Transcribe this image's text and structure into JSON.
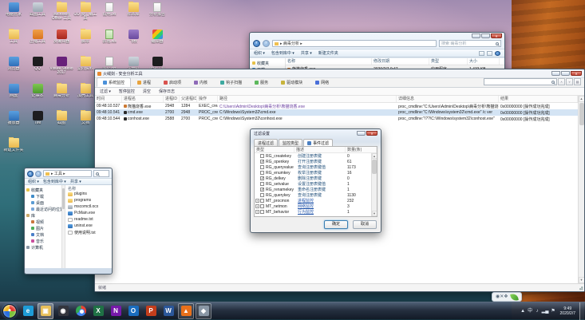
{
  "desktop": {
    "icons": [
      {
        "kind": "app-blue",
        "label": "电脑管家"
      },
      {
        "kind": "app-gray",
        "label": "截图工具"
      },
      {
        "kind": "folder",
        "label": "Microsoft Office 工具"
      },
      {
        "kind": "folder",
        "label": "OD 反汇编工具"
      },
      {
        "kind": "doc",
        "label": "说明.txt"
      },
      {
        "kind": "folder",
        "label": "样本库"
      },
      {
        "kind": "doc",
        "label": "分析报告"
      },
      {
        "kind": "none",
        "label": ""
      },
      {
        "kind": "folder",
        "label": "工具"
      },
      {
        "kind": "app-orange",
        "label": "压缩工具"
      },
      {
        "kind": "app-red",
        "label": "反编译器"
      },
      {
        "kind": "folder",
        "label": "脚本"
      },
      {
        "kind": "doc-green",
        "label": "表格.xls"
      },
      {
        "kind": "app-purple",
        "label": "飞秋"
      },
      {
        "kind": "app-rainbow",
        "label": "编译器"
      },
      {
        "kind": "none",
        "label": ""
      },
      {
        "kind": "app-blue",
        "label": "浏览器"
      },
      {
        "kind": "app-black",
        "label": "QQ"
      },
      {
        "kind": "app-vs",
        "label": "Visual Studio 2017"
      },
      {
        "kind": "folder",
        "label": "逆向资料"
      },
      {
        "kind": "doc",
        "label": "笔记.txt"
      },
      {
        "kind": "app-gray",
        "label": "注册机"
      },
      {
        "kind": "app-black",
        "label": "爬虫工具"
      },
      {
        "kind": "none",
        "label": ""
      },
      {
        "kind": "app-blue",
        "label": "网盘"
      },
      {
        "kind": "app-green",
        "label": "记事本"
      },
      {
        "kind": "folder",
        "label": "病毒分析"
      },
      {
        "kind": "folder",
        "label": "加壳工具"
      },
      {
        "kind": "app-redx",
        "label": "专杀工具"
      },
      {
        "kind": "app-orange",
        "label": "火狐浏览器"
      },
      {
        "kind": "none",
        "label": ""
      },
      {
        "kind": "none",
        "label": ""
      },
      {
        "kind": "app-blue",
        "label": "播放器"
      },
      {
        "kind": "app-black",
        "label": "TIM"
      },
      {
        "kind": "folder",
        "label": "截图"
      },
      {
        "kind": "folder",
        "label": "文档"
      },
      {
        "kind": "folder",
        "label": "资源"
      },
      {
        "kind": "none",
        "label": ""
      },
      {
        "kind": "none",
        "label": ""
      },
      {
        "kind": "none",
        "label": ""
      },
      {
        "kind": "folder",
        "label": "新建文件夹"
      },
      {
        "kind": "none",
        "label": ""
      },
      {
        "kind": "none",
        "label": ""
      },
      {
        "kind": "none",
        "label": ""
      },
      {
        "kind": "none",
        "label": ""
      },
      {
        "kind": "none",
        "label": ""
      },
      {
        "kind": "none",
        "label": ""
      },
      {
        "kind": "none",
        "label": ""
      }
    ]
  },
  "explorer_top": {
    "address": "▸ 病毒分析 ▸",
    "search_text": "搜索 病毒分析",
    "toolbar": [
      {
        "label": "组织 ▾"
      },
      {
        "label": "包含到库中 ▾"
      },
      {
        "label": "共享 ▾"
      },
      {
        "label": "新建文件夹"
      }
    ],
    "columns": [
      "名称",
      "修改日期",
      "类型",
      "大小"
    ],
    "sidebar": [
      {
        "label": "收藏夹",
        "color": "#e8c34a"
      },
      {
        "label": "下载",
        "color": "#3f8cc9"
      },
      {
        "label": "桌面",
        "color": "#5a9bd4"
      },
      {
        "label": "最近访问的位置",
        "color": "#7aa7d9"
      }
    ],
    "files": [
      {
        "name": "熊猫烧香.exe",
        "date": "2020/2/7 9:47",
        "type": "应用程序",
        "size": "1,433 KB",
        "color": "#cc7a33"
      }
    ]
  },
  "monitor": {
    "title": "火绒剑 - 安全分析工具",
    "tabs": [
      {
        "label": "系统监控",
        "color": "#4a90d9",
        "active": true
      },
      {
        "label": "进程",
        "color": "#e8a33d"
      },
      {
        "label": "启动项",
        "color": "#d9534f"
      },
      {
        "label": "内核",
        "color": "#8e6ab8"
      },
      {
        "label": "钩子扫描",
        "color": "#3da9a0"
      },
      {
        "label": "服务",
        "color": "#5cb85c"
      },
      {
        "label": "驱动模块",
        "color": "#c8b43c"
      },
      {
        "label": "网络",
        "color": "#4a6fd9"
      }
    ],
    "toolbar_items": [
      {
        "label": "过滤 ▾"
      },
      {
        "label": "暂停监控"
      },
      {
        "label": "清空"
      },
      {
        "label": "保存日志"
      }
    ],
    "columns": [
      "时间",
      "进程名",
      "进程ID",
      "父进程ID",
      "操作",
      "路径",
      "详细信息",
      "结果"
    ],
    "rows": [
      {
        "time": "09:48:10.537",
        "name": "熊猫烧香.exe",
        "color": "#cc7a33",
        "pid": "2948",
        "ppid": "1284",
        "op": "EXEC_create",
        "path": "C:\\Users\\Admin\\Desktop\\病毒分析\\熊猫烧香.exe",
        "detail": "proc_cmdline:\"C:\\Users\\Admin\\Desktop\\病毒分析\\熊猫烧香.exe\"",
        "result": "0x00000000 [操作成功完成]",
        "hl": true
      },
      {
        "time": "09:48:10.541",
        "name": "cmd.exe",
        "color": "#2b2b2b",
        "pid": "2700",
        "ppid": "2948",
        "op": "PROC_create",
        "path": "C:\\Windows\\System32\\cmd.exe",
        "detail": "proc_cmdline:\"C:\\Windows\\system32\\cmd.exe\" /c ver",
        "result": "0x00000000 [操作成功完成]",
        "selected": true
      },
      {
        "time": "09:48:10.544",
        "name": "conhost.exe",
        "color": "#2b2b2b",
        "pid": "2588",
        "ppid": "2700",
        "op": "PROC_create",
        "path": "C:\\Windows\\System32\\conhost.exe",
        "detail": "proc_cmdline:\"\\??\\C:\\Windows\\system32\\conhost.exe\"",
        "result": "0x00000000 [操作成功完成]"
      }
    ],
    "status": "就绪"
  },
  "filter_dialog": {
    "title": "过滤设置",
    "tabs": [
      {
        "label": "进程过滤"
      },
      {
        "label": "监控类型"
      },
      {
        "label": "事件过滤",
        "active": true
      }
    ],
    "columns": [
      "类型",
      "描述",
      "数量(条)"
    ],
    "items": [
      {
        "name": "RG_createkey",
        "desc": "创建注册表键",
        "count": "0"
      },
      {
        "name": "RG_openkey",
        "desc": "打开注册表键",
        "count": "61",
        "checked": true
      },
      {
        "name": "RG_queryvalue",
        "desc": "查询注册表键值",
        "count": "1173"
      },
      {
        "name": "RG_enumkey",
        "desc": "枚举注册表键",
        "count": "16"
      },
      {
        "name": "RG_delkey",
        "desc": "删除注册表键",
        "count": "0",
        "checked": true
      },
      {
        "name": "RG_setvalue",
        "desc": "设置注册表键值",
        "count": "1"
      },
      {
        "name": "RG_renamekey",
        "desc": "重命名注册表键",
        "count": "1",
        "checked": true
      },
      {
        "name": "RG_querykey",
        "desc": "查询注册表键",
        "count": "1130"
      },
      {
        "name": "MT_procmon",
        "desc": "进程监控",
        "count": "232",
        "group": true
      },
      {
        "name": "MT_netmon",
        "desc": "网络监控",
        "count": "3",
        "group": true
      },
      {
        "name": "MT_behavior",
        "desc": "行为监控",
        "count": "1",
        "group": true
      }
    ],
    "ok": "确定",
    "cancel": "取消"
  },
  "explorer_small": {
    "address": "▸ 工具 ▸",
    "toolbar": [
      {
        "label": "组织 ▾"
      },
      {
        "label": "包含到库中 ▾"
      },
      {
        "label": "共享 ▾"
      }
    ],
    "files_header": "名称",
    "sidebar": [
      {
        "label": "收藏夹",
        "color": "#e8c34a",
        "header": true
      },
      {
        "label": "下载",
        "color": "#3f8cc9"
      },
      {
        "label": "桌面",
        "color": "#5a9bd4"
      },
      {
        "label": "最近访问的位置",
        "color": "#7aa7d9"
      },
      {
        "label": "库",
        "color": "#caa96a",
        "header": true
      },
      {
        "label": "视频",
        "color": "#c9763f"
      },
      {
        "label": "图片",
        "color": "#4fae5c"
      },
      {
        "label": "文档",
        "color": "#4a7fc9"
      },
      {
        "label": "音乐",
        "color": "#c94f9e"
      },
      {
        "label": "计算机",
        "color": "#8a97a5",
        "header": true
      }
    ],
    "files": [
      {
        "name": "plugins",
        "kind": "folder"
      },
      {
        "name": "programs",
        "kind": "folder"
      },
      {
        "name": "mscomctl.ocx",
        "kind": "ocx"
      },
      {
        "name": "PcMain.exe",
        "kind": "exe"
      },
      {
        "name": "readme.txt",
        "kind": "doc"
      },
      {
        "name": "uninst.exe",
        "kind": "exe"
      },
      {
        "name": "使用说明.txt",
        "kind": "doc"
      }
    ]
  },
  "taskbar": {
    "buttons": [
      {
        "name": "ie",
        "glyph": "e",
        "color": "#1e9cd7"
      },
      {
        "name": "explorer",
        "glyph": "▣",
        "color": "#e8c05a",
        "active": true
      },
      {
        "name": "media-player",
        "glyph": "◉",
        "color": "#33353d"
      },
      {
        "name": "chrome",
        "glyph": "",
        "kind": "chrome"
      },
      {
        "name": "excel",
        "glyph": "X",
        "color": "#1f7145"
      },
      {
        "name": "onenote",
        "glyph": "N",
        "color": "#7719aa"
      },
      {
        "name": "outlook",
        "glyph": "O",
        "color": "#1a6dbf"
      },
      {
        "name": "powerpoint",
        "glyph": "P",
        "color": "#c43e1c"
      },
      {
        "name": "word",
        "glyph": "W",
        "color": "#2b579a"
      },
      {
        "name": "huorong",
        "glyph": "▲",
        "color": "#e8701a",
        "pressed": true
      },
      {
        "name": "security",
        "glyph": "◆",
        "color": "#8a97a5",
        "pressed": true
      }
    ],
    "tray_icons": [
      {
        "glyph": "▲"
      },
      {
        "glyph": "中"
      },
      {
        "glyph": "♪"
      },
      {
        "glyph": "▂▄"
      },
      {
        "glyph": "⚑"
      }
    ],
    "clock_time": "9:49",
    "clock_date": "2020/2/7"
  },
  "widget": {
    "icons": [
      {
        "glyph": "◉"
      },
      {
        "glyph": "✕"
      },
      {
        "glyph": "❖"
      }
    ]
  }
}
